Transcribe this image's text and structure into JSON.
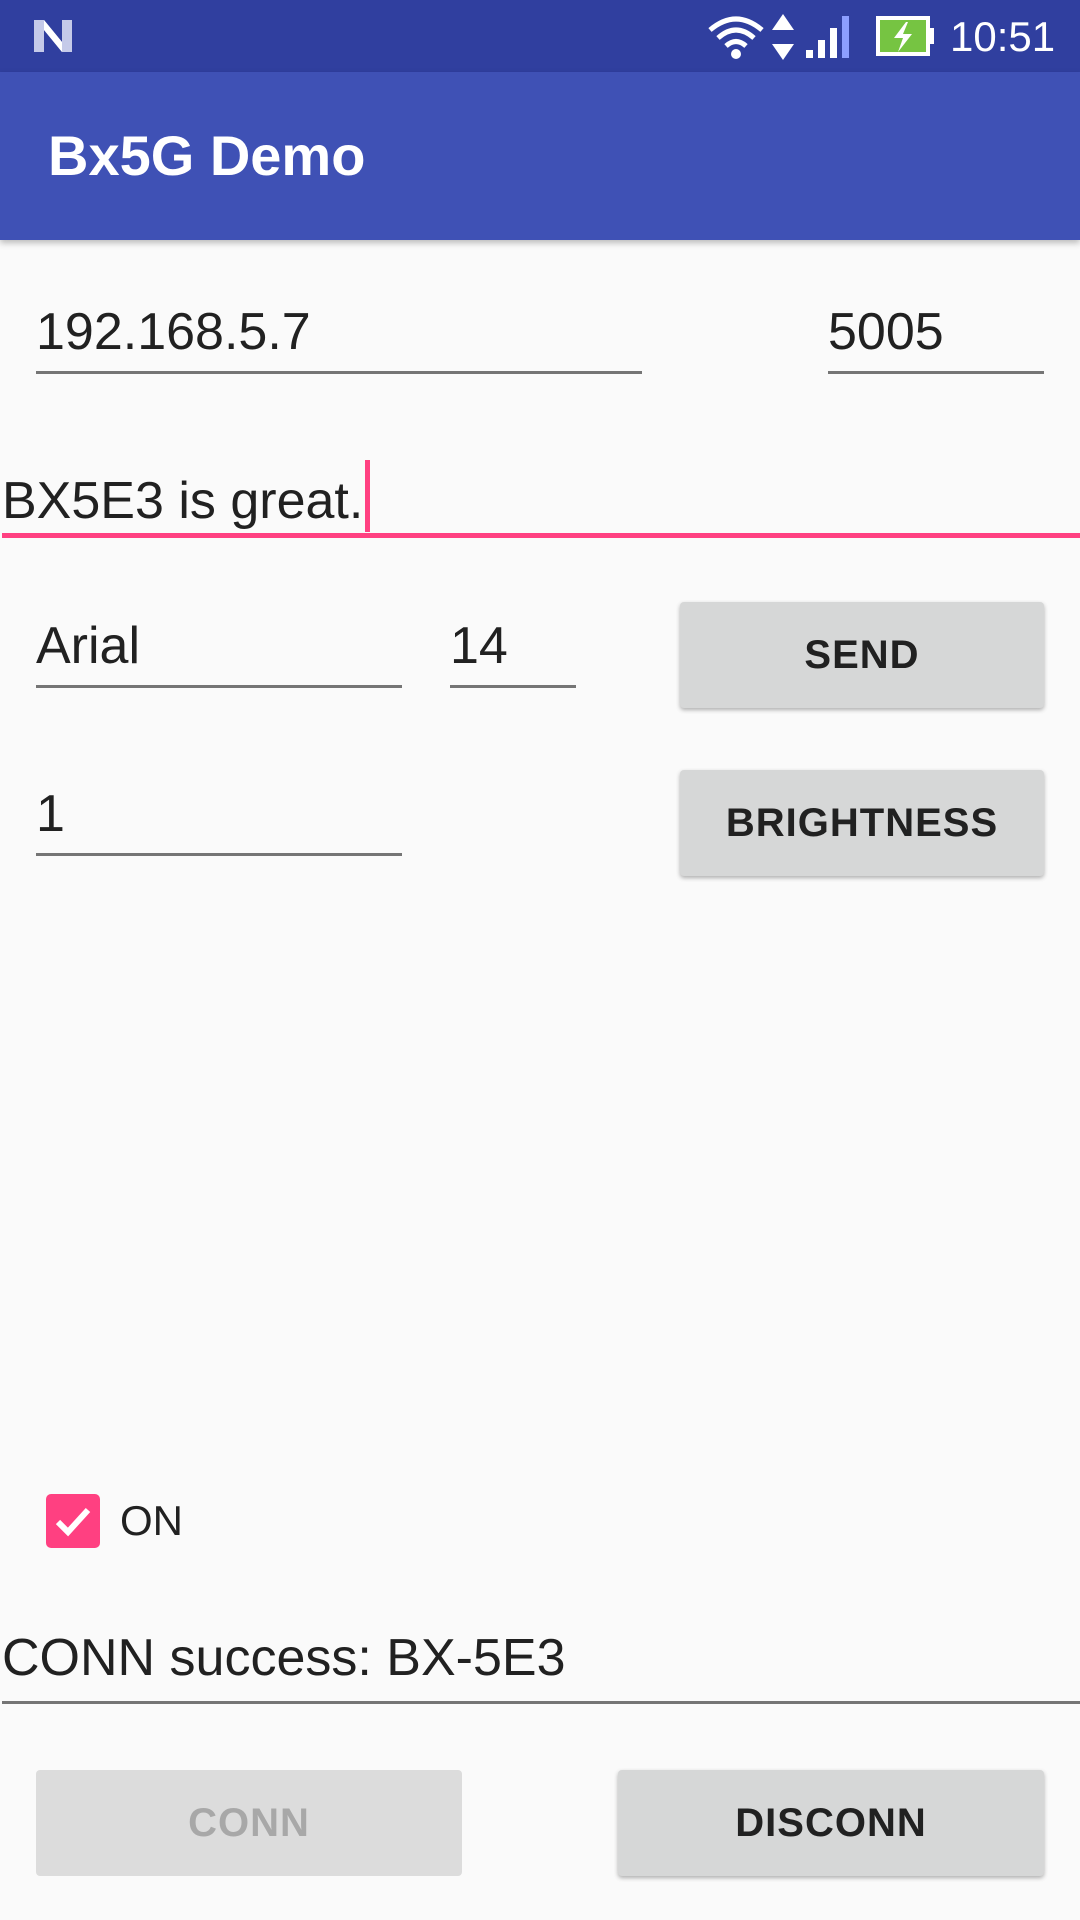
{
  "status_bar": {
    "time": "10:51",
    "icons": [
      "n-logo-icon",
      "wifi-icon",
      "data-arrows-icon",
      "signal-icon",
      "battery-charging-icon"
    ]
  },
  "app_bar": {
    "title": "Bx5G Demo"
  },
  "form": {
    "ip_address": "192.168.5.7",
    "port": "5005",
    "message": "BX5E3 is great.",
    "font_name": "Arial",
    "font_size": "14",
    "send_label": "SEND",
    "brightness_value": "1",
    "brightness_label": "BRIGHTNESS",
    "power_checkbox": {
      "label": "ON",
      "checked": true
    },
    "status_text": "CONN success: BX-5E3",
    "conn_label": "CONN",
    "disconn_label": "DISCONN"
  },
  "colors": {
    "status_bar": "#303f9f",
    "app_bar": "#3f51b5",
    "accent": "#ff4081",
    "battery": "#76c442"
  }
}
